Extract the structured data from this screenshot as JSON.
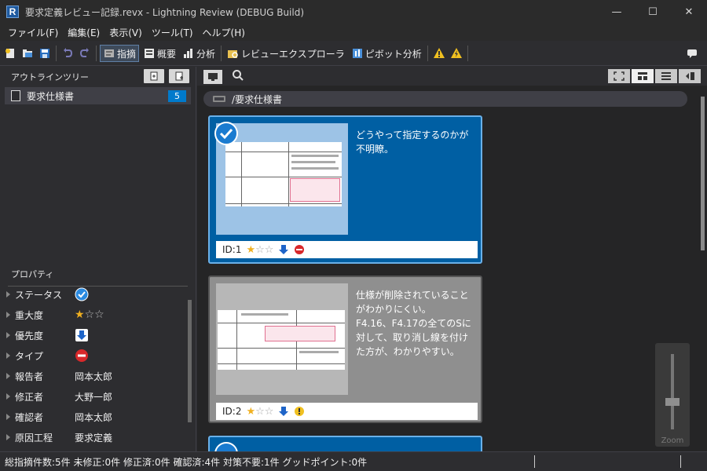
{
  "window": {
    "title": "要求定義レビュー記録.revx - Lightning Review (DEBUG Build)",
    "app_icon_letter": "R",
    "minimize": "—",
    "maximize": "☐",
    "close": "✕"
  },
  "menu": [
    "ファイル(F)",
    "編集(E)",
    "表示(V)",
    "ツール(T)",
    "ヘルプ(H)"
  ],
  "toolbar": {
    "shiteki": "指摘",
    "gaiyou": "概要",
    "bunseki": "分析",
    "explorer": "レビューエクスプローラ",
    "pivot": "ピボット分析"
  },
  "outline": {
    "title": "アウトラインツリー",
    "items": [
      {
        "label": "要求仕様書",
        "count": "5"
      }
    ]
  },
  "properties": {
    "title": "プロパティ",
    "rows": [
      {
        "name": "ステータス",
        "value": ""
      },
      {
        "name": "重大度",
        "value": ""
      },
      {
        "name": "優先度",
        "value": ""
      },
      {
        "name": "タイプ",
        "value": ""
      },
      {
        "name": "報告者",
        "value": "岡本太郎"
      },
      {
        "name": "修正者",
        "value": "大野一郎"
      },
      {
        "name": "確認者",
        "value": "岡本太郎"
      },
      {
        "name": "原因工程",
        "value": "要求定義"
      }
    ]
  },
  "path": "/要求仕様書",
  "cards": [
    {
      "id": "ID:1",
      "text": "どうやって指定するのかが不明瞭。",
      "status": "checked"
    },
    {
      "id": "ID:2",
      "text": "仕様が削除されていることがわかりにくい。\nF4.16、F4.17の全てのSに対して、取り消し線を付けた方が、わかりやすい。",
      "status": "warning"
    }
  ],
  "zoom_label": "Zoom",
  "statusbar": "総指摘件数:5件 未修正:0件 修正済:0件 確認済:4件 対策不要:1件 グッドポイント:0件",
  "colors": {
    "accent": "#007acc",
    "card_selected": "#005fa3",
    "card_normal": "#8f8f8f"
  }
}
